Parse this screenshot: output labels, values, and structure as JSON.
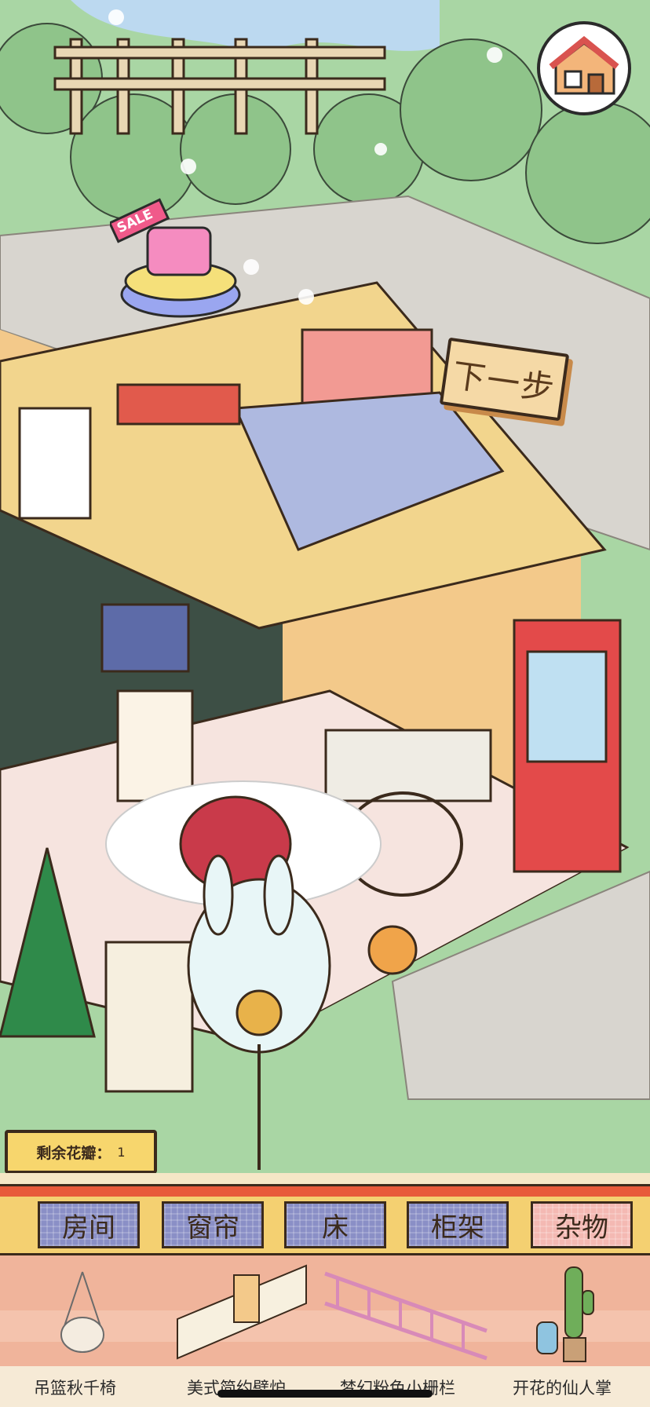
{
  "next_button": {
    "label": "下一步"
  },
  "petals_counter": {
    "label": "剩余花瓣：",
    "count": "1"
  },
  "sale_badge": {
    "label": "SALE"
  },
  "tabs": [
    {
      "label": "房间"
    },
    {
      "label": "窗帘"
    },
    {
      "label": "床"
    },
    {
      "label": "柜架"
    },
    {
      "label": "杂物"
    }
  ],
  "active_tab": "杂物",
  "items": [
    {
      "label": "吊篮秋千椅",
      "icon": "hanging-chair-icon"
    },
    {
      "label": "美式简约壁炉",
      "icon": "fireplace-fence-icon"
    },
    {
      "label": "梦幻粉色小栅栏",
      "icon": "pink-fence-icon"
    },
    {
      "label": "开花的仙人掌",
      "icon": "cactus-icon"
    }
  ],
  "colors": {
    "accent_red": "#e85a3a",
    "tab_bg": "#8a8fc6",
    "active_tab_bg": "#f4b9b3",
    "tray_bg": "#f0b49b"
  }
}
